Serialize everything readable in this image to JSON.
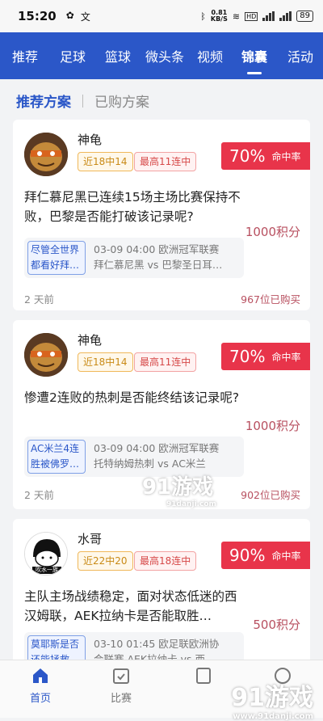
{
  "status_bar": {
    "time": "15:20",
    "net_speed_value": "0.81",
    "net_speed_unit": "KB/S",
    "battery": "89",
    "network_type": "HD"
  },
  "top_nav": {
    "tabs": [
      "推荐",
      "足球",
      "篮球",
      "微头条",
      "视频",
      "锦囊",
      "活动"
    ],
    "active": "锦囊"
  },
  "sub_tabs": {
    "active": "推荐方案",
    "inactive": "已购方案"
  },
  "rate_label": "命中率",
  "cards": [
    {
      "author": "神龟",
      "streak_tag": "近18中14",
      "max_tag": "最高11连中",
      "rate": "70%",
      "title": "拜仁慕尼黑已连续15场主场比赛保持不败，巴黎是否能打破该记录呢?",
      "price": "1000积分",
      "pick": "尽管全世界都看好拜…",
      "match_time": "03-09 04:00 欧洲冠军联赛",
      "match_teams": "拜仁慕尼黑 vs 巴黎圣日耳…",
      "ago": "2 天前",
      "bought": "967位已购买"
    },
    {
      "author": "神龟",
      "streak_tag": "近18中14",
      "max_tag": "最高11连中",
      "rate": "70%",
      "title": "惨遭2连败的热刺是否能终结该记录呢?",
      "price": "1000积分",
      "pick": "AC米兰4连胜被佛罗…",
      "match_time": "03-09 04:00 欧洲冠军联赛",
      "match_teams": "托特纳姆热刺 vs AC米兰",
      "ago": "2 天前",
      "bought": "902位已购买"
    },
    {
      "author": "水哥",
      "streak_tag": "近22中20",
      "max_tag": "最高18连中",
      "rate": "90%",
      "title": "主队主场战绩稳定，面对状态低迷的西汉姆联，AEK拉纳卡是否能取胜…",
      "price": "500积分",
      "avatar_caption": "吹水一族",
      "pick": "莫耶斯是否还能拯救…",
      "match_time": "03-10 01:45 欧足联欧洲协",
      "match_teams": "会联赛 AEK拉纳卡 vs 西…"
    }
  ],
  "bottom_nav": {
    "items": [
      "首页",
      "比赛"
    ],
    "active": "首页"
  },
  "watermark": {
    "brand_mid": "91游戏",
    "brand_mid_url": "91danji.com",
    "brand_corner": "91游戏",
    "brand_corner_url": "www.91danji.com"
  },
  "colors": {
    "primary": "#2b57c8",
    "rate_red": "#e8344a",
    "price": "#b85060"
  }
}
